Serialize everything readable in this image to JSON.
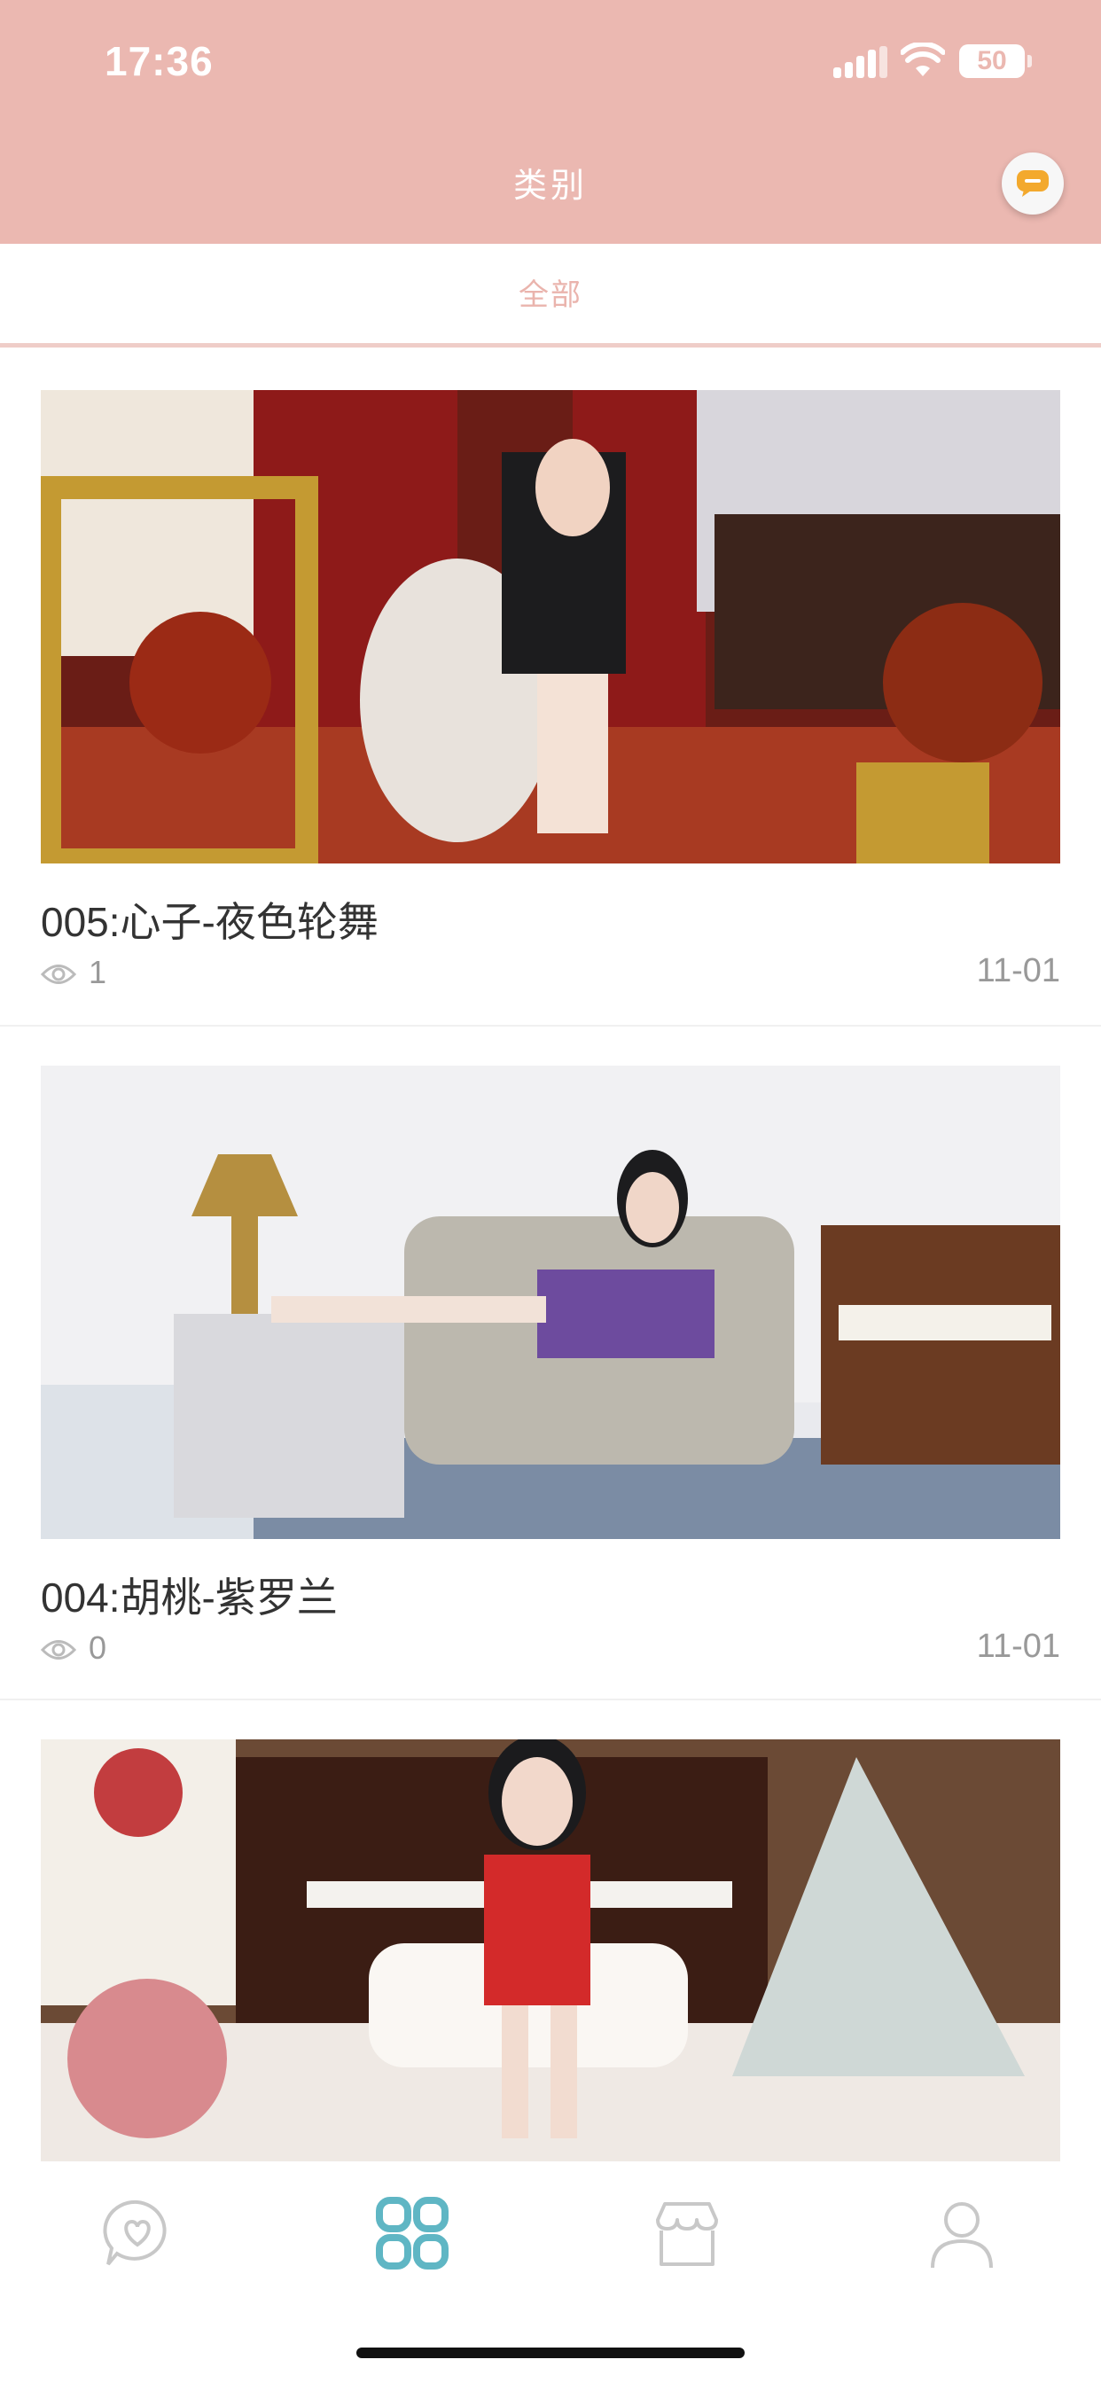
{
  "status_bar": {
    "time": "17:36",
    "battery": "50"
  },
  "nav": {
    "title": "类别"
  },
  "tabs": [
    {
      "label": "全部",
      "selected": true
    }
  ],
  "posts": [
    {
      "title": "005:心子-夜色轮舞",
      "views": "1",
      "date": "11-01"
    },
    {
      "title": "004:胡桃-紫罗兰",
      "views": "0",
      "date": "11-01"
    },
    {
      "title": "",
      "views": "",
      "date": ""
    }
  ],
  "bottom_nav": [
    {
      "icon": "chat-heart-icon",
      "active": false
    },
    {
      "icon": "grid-icon",
      "active": true
    },
    {
      "icon": "shop-icon",
      "active": false
    },
    {
      "icon": "profile-icon",
      "active": false
    }
  ],
  "colors": {
    "header": "#ebb8b1",
    "accent": "#5fb6c4",
    "tab_text": "#eab4ad"
  }
}
